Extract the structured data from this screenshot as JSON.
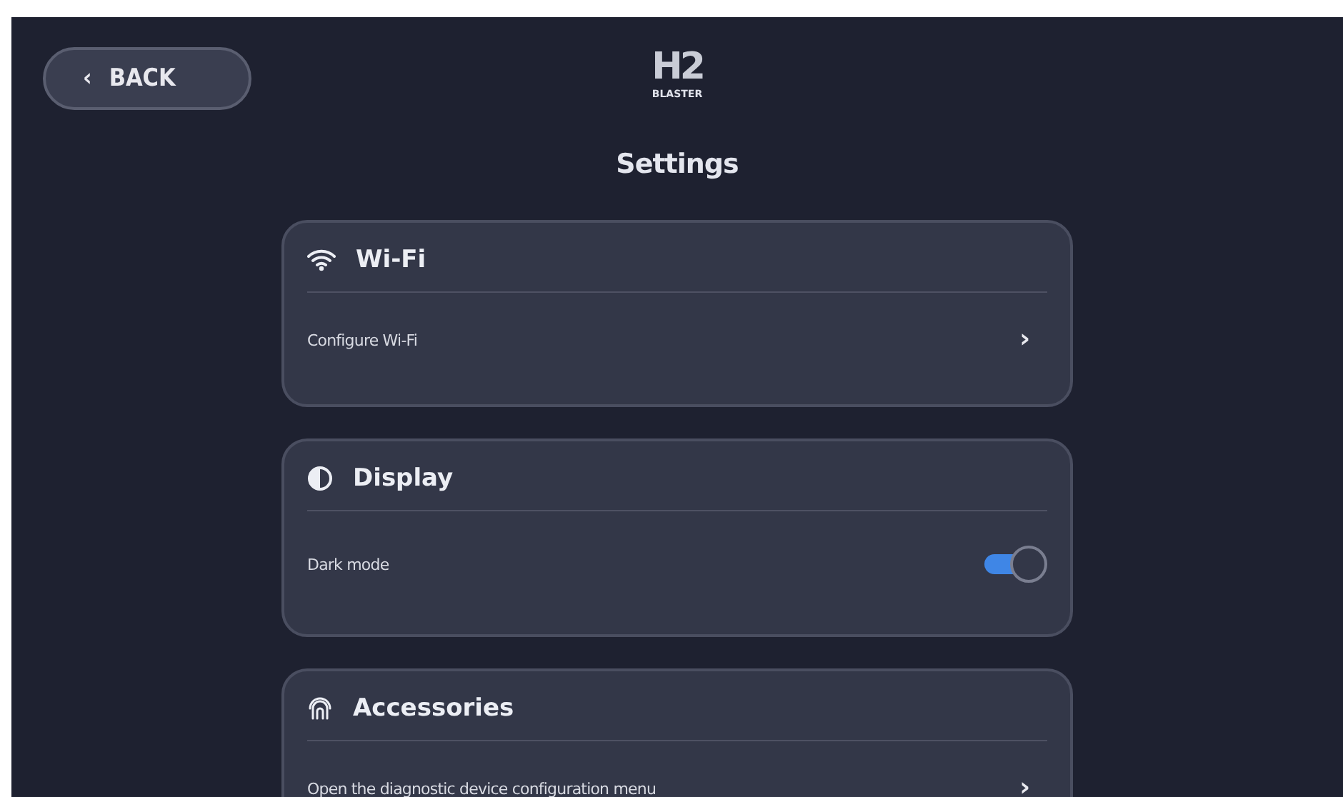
{
  "back_button": {
    "label": "BACK",
    "icon": "‹"
  },
  "logo": {
    "mark": "H2",
    "sub": "BLASTER"
  },
  "title": "Settings",
  "sections": [
    {
      "title": "Wi-Fi",
      "kind": "wifi",
      "rows": [
        {
          "kind": "link",
          "label": "Configure Wi-Fi",
          "chevron": "›"
        }
      ]
    },
    {
      "title": "Display",
      "kind": "contrast",
      "rows": [
        {
          "kind": "toggle",
          "label": "Dark mode",
          "on": true
        }
      ]
    },
    {
      "title": "Accessories",
      "kind": "accessory",
      "rows": [
        {
          "kind": "link",
          "label": "Open the diagnostic device configuration menu",
          "chevron": "›"
        }
      ]
    }
  ]
}
